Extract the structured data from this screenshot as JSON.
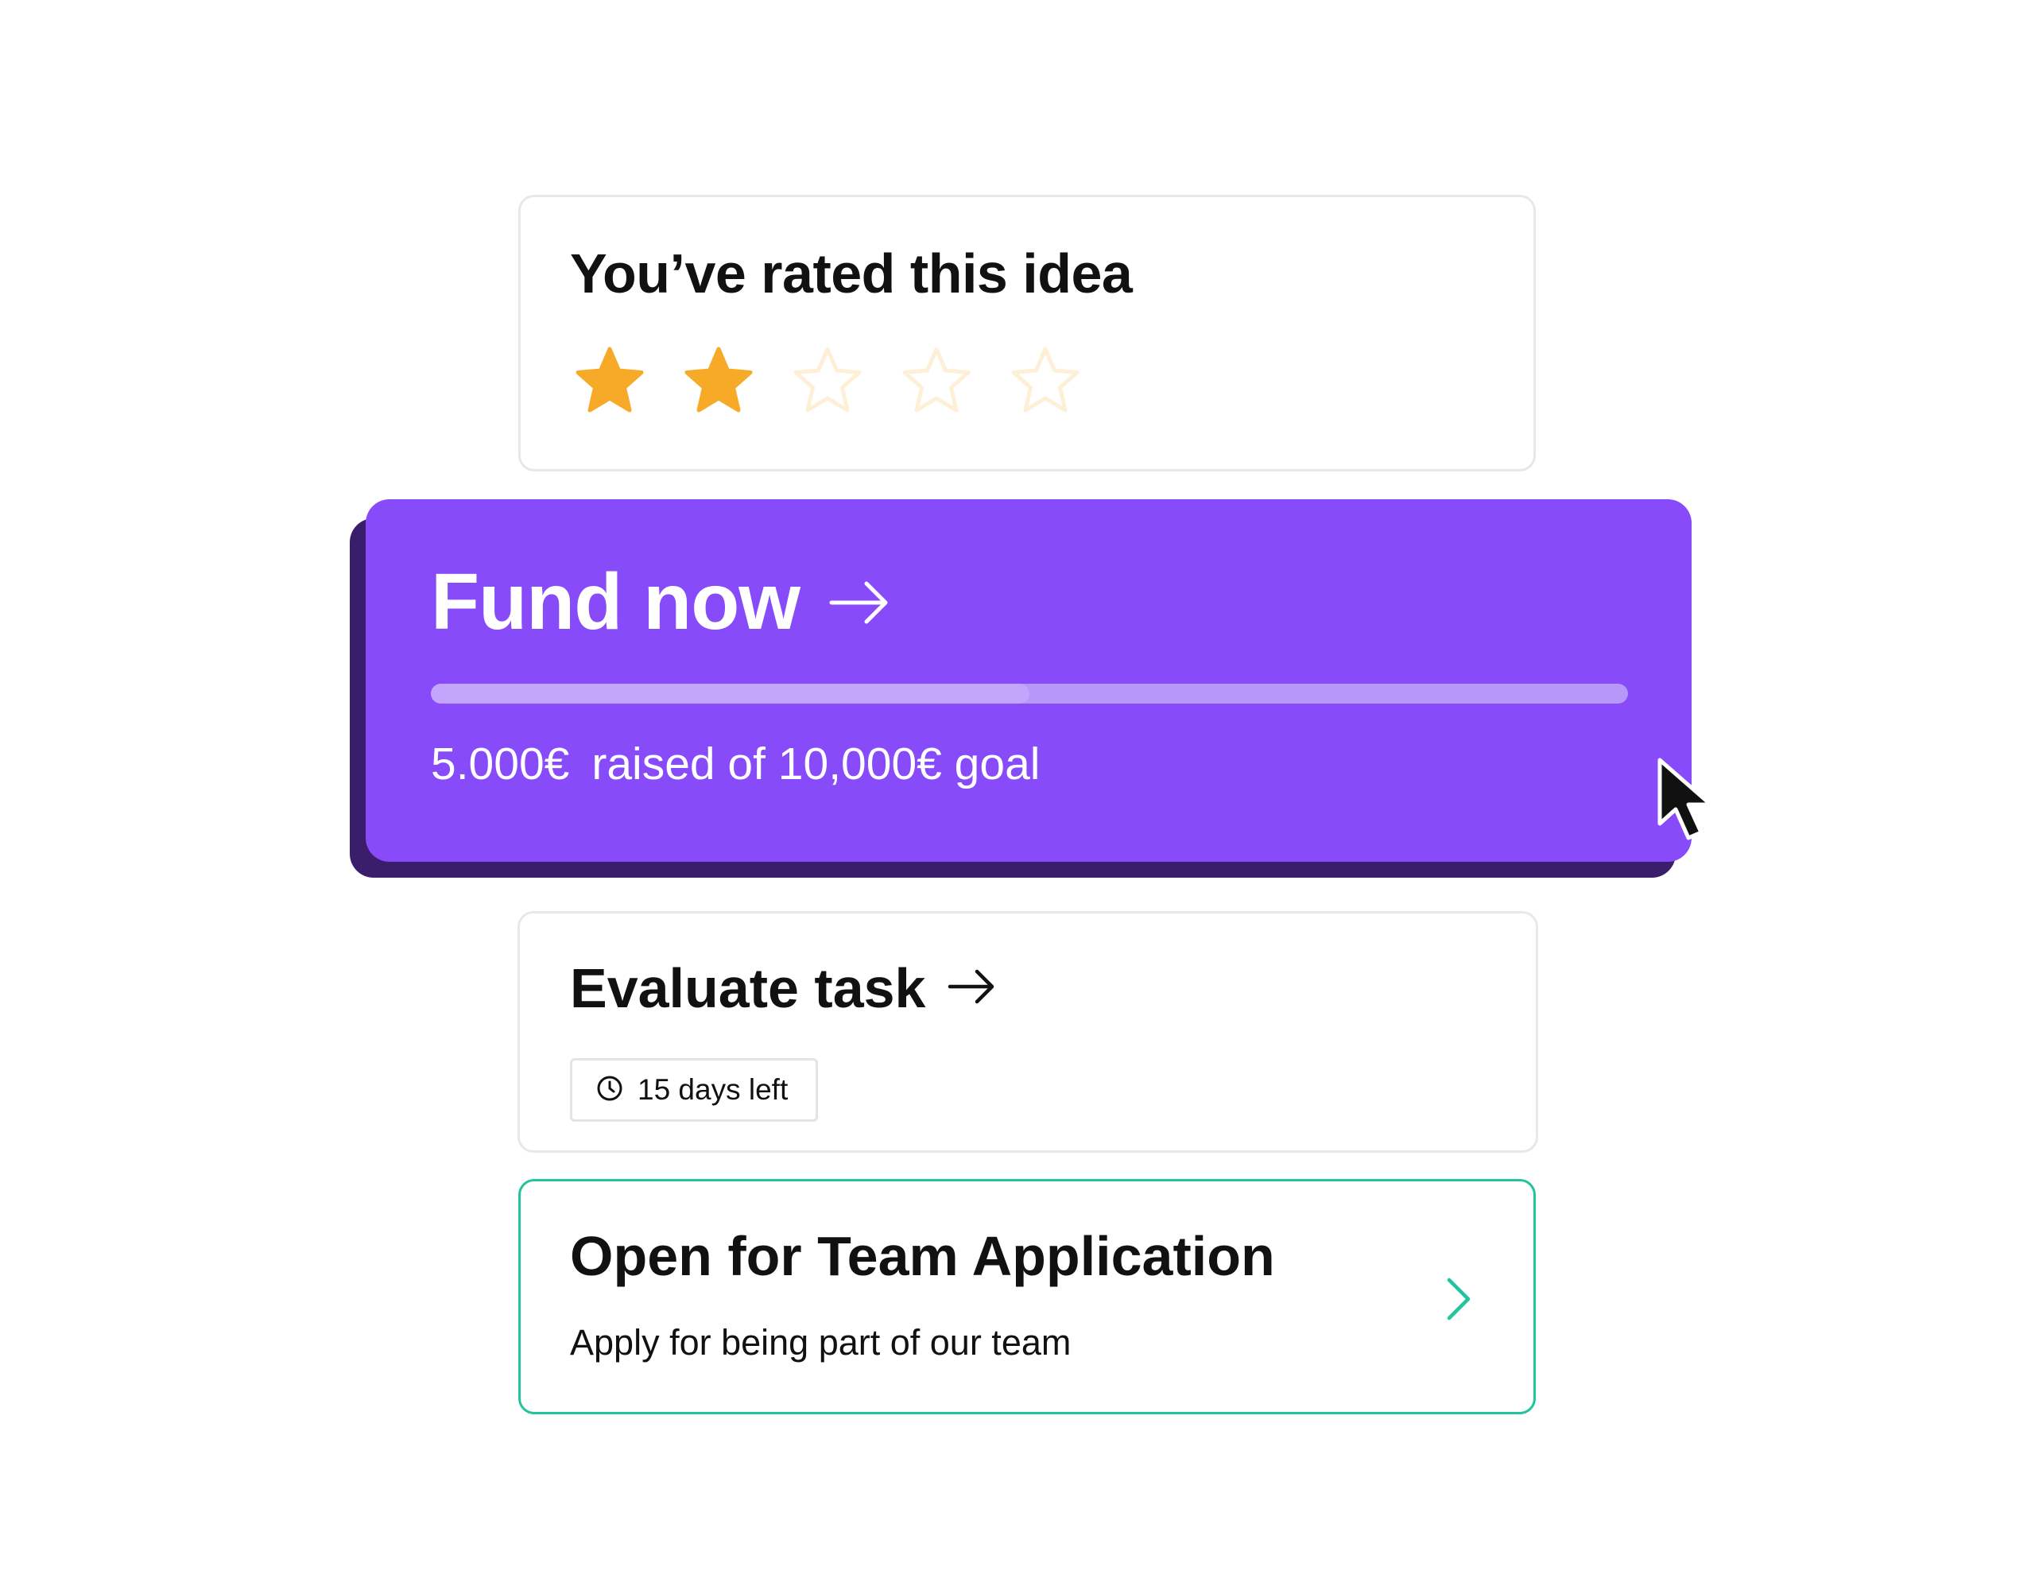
{
  "rating": {
    "title": "You’ve rated this idea",
    "value": 2,
    "max": 5,
    "filled_color": "#f7a928",
    "empty_color": "#fdf0d6"
  },
  "fund": {
    "label": "Fund now",
    "arrow_icon": "arrow-right-icon",
    "progress_fraction": 0.5,
    "raised_amount": "5.000€",
    "raised_text": "raised of 10,000€ goal",
    "bg_color": "#874bfa",
    "shadow_color": "#3b1e6b"
  },
  "evaluate": {
    "label": "Evaluate task",
    "arrow_icon": "arrow-right-icon",
    "days_icon": "clock-icon",
    "days_left": "15 days left"
  },
  "team": {
    "title": "Open for Team Application",
    "subtitle": "Apply for being part of our team",
    "chevron_icon": "chevron-right-icon",
    "accent_color": "#22c49b"
  },
  "cursor_icon": "mouse-pointer-icon"
}
